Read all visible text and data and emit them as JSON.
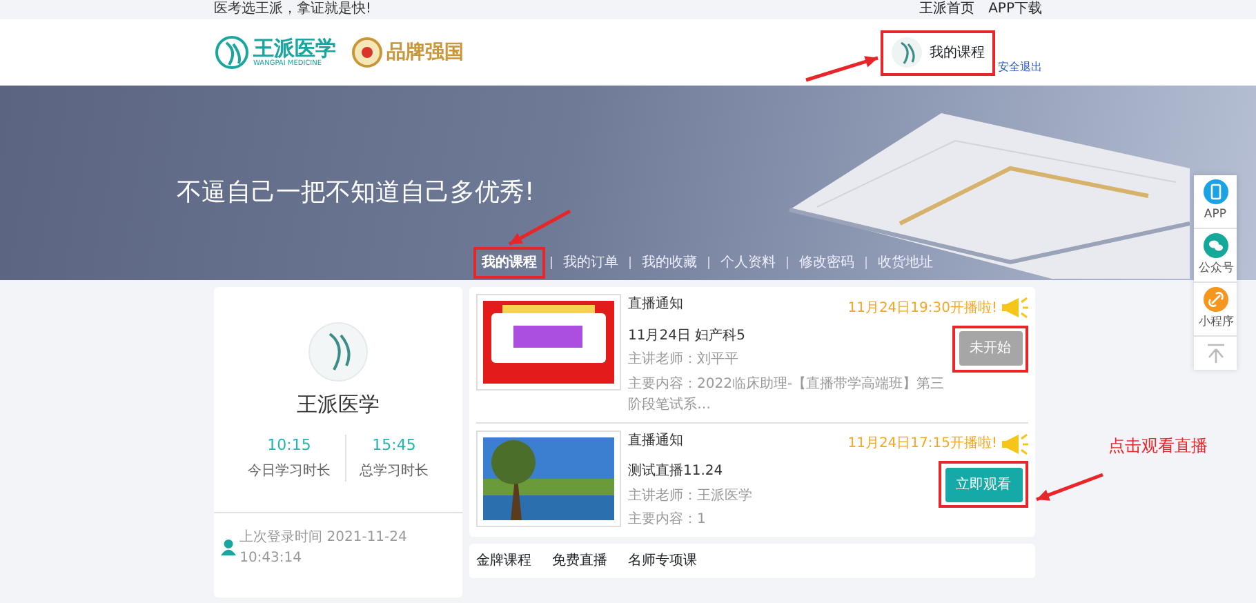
{
  "top_bar": {
    "slogan": "医考选王派，拿证就是快!",
    "links": [
      "王派首页",
      "APP下载"
    ]
  },
  "header": {
    "logo_text": "王派医学",
    "logo_sub": "WANGPAI MEDICINE",
    "brand_text": "品牌强国",
    "user": {
      "label": "我的课程",
      "highlighted": true,
      "arrow": true
    },
    "logout": "安全退出"
  },
  "banner": {
    "slogan": "不逼自己一把不知道自己多优秀!"
  },
  "tabs": [
    {
      "label": "我的课程",
      "selected": true,
      "highlighted": true,
      "arrow": true
    },
    {
      "label": "我的订单",
      "selected": false,
      "highlighted": false,
      "arrow": false
    },
    {
      "label": "我的收藏",
      "selected": false,
      "highlighted": false,
      "arrow": false
    },
    {
      "label": "个人资料",
      "selected": false,
      "highlighted": false,
      "arrow": false
    },
    {
      "label": "修改密码",
      "selected": false,
      "highlighted": false,
      "arrow": false
    },
    {
      "label": "收货地址",
      "selected": false,
      "highlighted": false,
      "arrow": false
    }
  ],
  "profile": {
    "name": "王派医学",
    "stats": [
      {
        "value": "10:15",
        "label": "今日学习时长"
      },
      {
        "value": "15:45",
        "label": "总学习时长"
      }
    ],
    "last_login": "上次登录时间 2021-11-24 10:43:14"
  },
  "live_items": [
    {
      "thumbnail": {
        "kind": "poster"
      },
      "title": "直播通知",
      "subject": "11月24日 妇产科5",
      "teacher": "主讲老师：刘平平",
      "content": "主要内容：2022临床助理-【直播带学高端班】第三阶段笔试系…",
      "time": "11月24日19:30开播啦!",
      "button": {
        "label": "未开始",
        "disabled": true
      },
      "highlighted": true,
      "arrow": false
    },
    {
      "thumbnail": {
        "kind": "photo"
      },
      "title": "直播通知",
      "subject": "测试直播11.24",
      "teacher": "主讲老师：王派医学",
      "content": "主要内容：1",
      "time": "11月24日17:15开播啦!",
      "button": {
        "label": "立即观看",
        "disabled": false
      },
      "highlighted": true,
      "arrow": true,
      "callout": "点击观看直播"
    }
  ],
  "course_tabs": [
    "金牌课程",
    "免费直播",
    "名师专项课"
  ],
  "side_bar": [
    {
      "label": "APP",
      "kind": "phone",
      "color": "#1aa1e6"
    },
    {
      "label": "公众号",
      "kind": "chat",
      "color": "#14a89a"
    },
    {
      "label": "小程序",
      "kind": "link",
      "color": "#f5961e"
    }
  ]
}
